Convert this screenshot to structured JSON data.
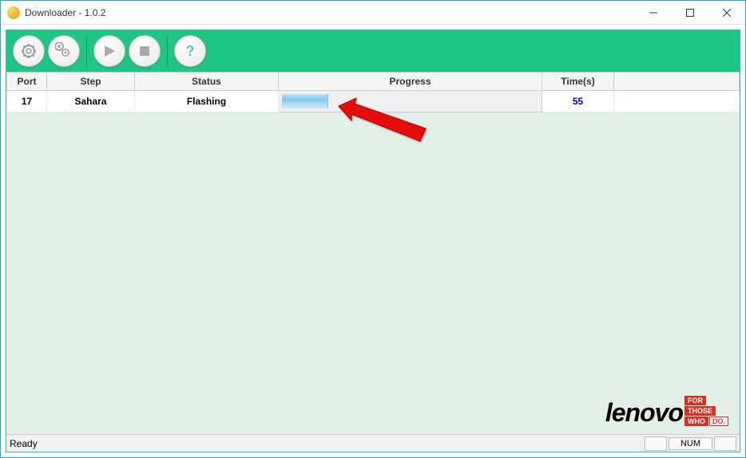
{
  "window": {
    "title": "Downloader - 1.0.2"
  },
  "toolbar": {
    "buttons": [
      "settings",
      "multi-settings",
      "start",
      "stop",
      "help"
    ]
  },
  "table": {
    "headers": {
      "port": "Port",
      "step": "Step",
      "status": "Status",
      "progress": "Progress",
      "time": "Time(s)"
    },
    "rows": [
      {
        "port": "17",
        "step": "Sahara",
        "status": "Flashing",
        "progress_percent": 18,
        "time": "55"
      }
    ]
  },
  "statusbar": {
    "left": "Ready",
    "num": "NUM"
  },
  "branding": {
    "name": "lenovo",
    "tag1": "FOR",
    "tag2": "THOSE",
    "tag3": "WHO",
    "tag4": "DO."
  }
}
